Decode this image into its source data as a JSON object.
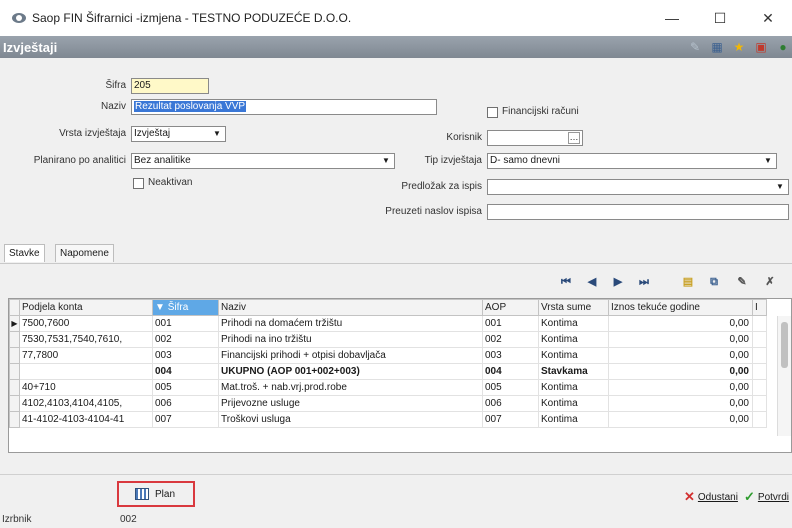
{
  "window": {
    "title": "Saop FIN Šifrarnici -izmjena  - TESTNO PODUZEĆE D.O.O.",
    "minimize": "—",
    "maximize": "☐",
    "close": "✕"
  },
  "header": {
    "title": "Izvještaji"
  },
  "form": {
    "sifra": {
      "label": "Šifra",
      "value": "205"
    },
    "naziv": {
      "label": "Naziv",
      "value": "Rezultat poslovanja VVP"
    },
    "financijski_racuni": {
      "label": "Financijski računi",
      "checked": false
    },
    "vrsta_izvjestaja": {
      "label": "Vrsta izvještaja",
      "value": "Izvještaj"
    },
    "korisnik": {
      "label": "Korisnik",
      "value": "",
      "button": "…"
    },
    "planirano_po_analitici": {
      "label": "Planirano po analitici",
      "value": "Bez analitike"
    },
    "tip_izvjestaja": {
      "label": "Tip izvještaja",
      "value": "D- samo dnevni"
    },
    "neaktivan": {
      "label": "Neaktivan",
      "checked": false
    },
    "predlozak_za_ispis": {
      "label": "Predložak za ispis",
      "value": ""
    },
    "preuzeti_naslov_ispisa": {
      "label": "Preuzeti naslov ispisa",
      "value": ""
    }
  },
  "tabs": [
    {
      "label": "Stavke",
      "active": true
    },
    {
      "label": "Napomene",
      "active": false
    }
  ],
  "grid": {
    "columns": [
      "Podjela konta",
      "Šifra",
      "Naziv",
      "AOP",
      "Vrsta sume",
      "Iznos tekuće godine",
      "I"
    ],
    "sorted_marker": "▼",
    "rows": [
      {
        "podjela": "7500,7600",
        "sifra": "001",
        "naziv": "Prihodi na domaćem tržištu",
        "aop": "001",
        "vrsta": "Kontima",
        "iznos": "0,00",
        "current": true,
        "bold": false
      },
      {
        "podjela": "7530,7531,7540,7610,",
        "sifra": "002",
        "naziv": "Prihodi na ino tržištu",
        "aop": "002",
        "vrsta": "Kontima",
        "iznos": "0,00",
        "current": false,
        "bold": false
      },
      {
        "podjela": "77,7800",
        "sifra": "003",
        "naziv": "Financijski prihodi + otpisi dobavljača",
        "aop": "003",
        "vrsta": "Kontima",
        "iznos": "0,00",
        "current": false,
        "bold": false
      },
      {
        "podjela": "",
        "sifra": "004",
        "naziv": "UKUPNO (AOP 001+002+003)",
        "aop": "004",
        "vrsta": "Stavkama",
        "iznos": "0,00",
        "current": false,
        "bold": true
      },
      {
        "podjela": "40+710",
        "sifra": "005",
        "naziv": "Mat.troš. + nab.vrj.prod.robe",
        "aop": "005",
        "vrsta": "Kontima",
        "iznos": "0,00",
        "current": false,
        "bold": false
      },
      {
        "podjela": "4102,4103,4104,4105,",
        "sifra": "006",
        "naziv": "Prijevozne usluge",
        "aop": "006",
        "vrsta": "Kontima",
        "iznos": "0,00",
        "current": false,
        "bold": false
      },
      {
        "podjela": "41-4102-4103-4104-41",
        "sifra": "007",
        "naziv": "Troškovi usluga",
        "aop": "007",
        "vrsta": "Kontima",
        "iznos": "0,00",
        "current": false,
        "bold": false
      }
    ]
  },
  "buttons": {
    "plan": "Plan",
    "odustani": "Odustani",
    "potvrdi": "Potvrdi"
  },
  "status": {
    "left": "Izrbnik",
    "value": "002"
  }
}
